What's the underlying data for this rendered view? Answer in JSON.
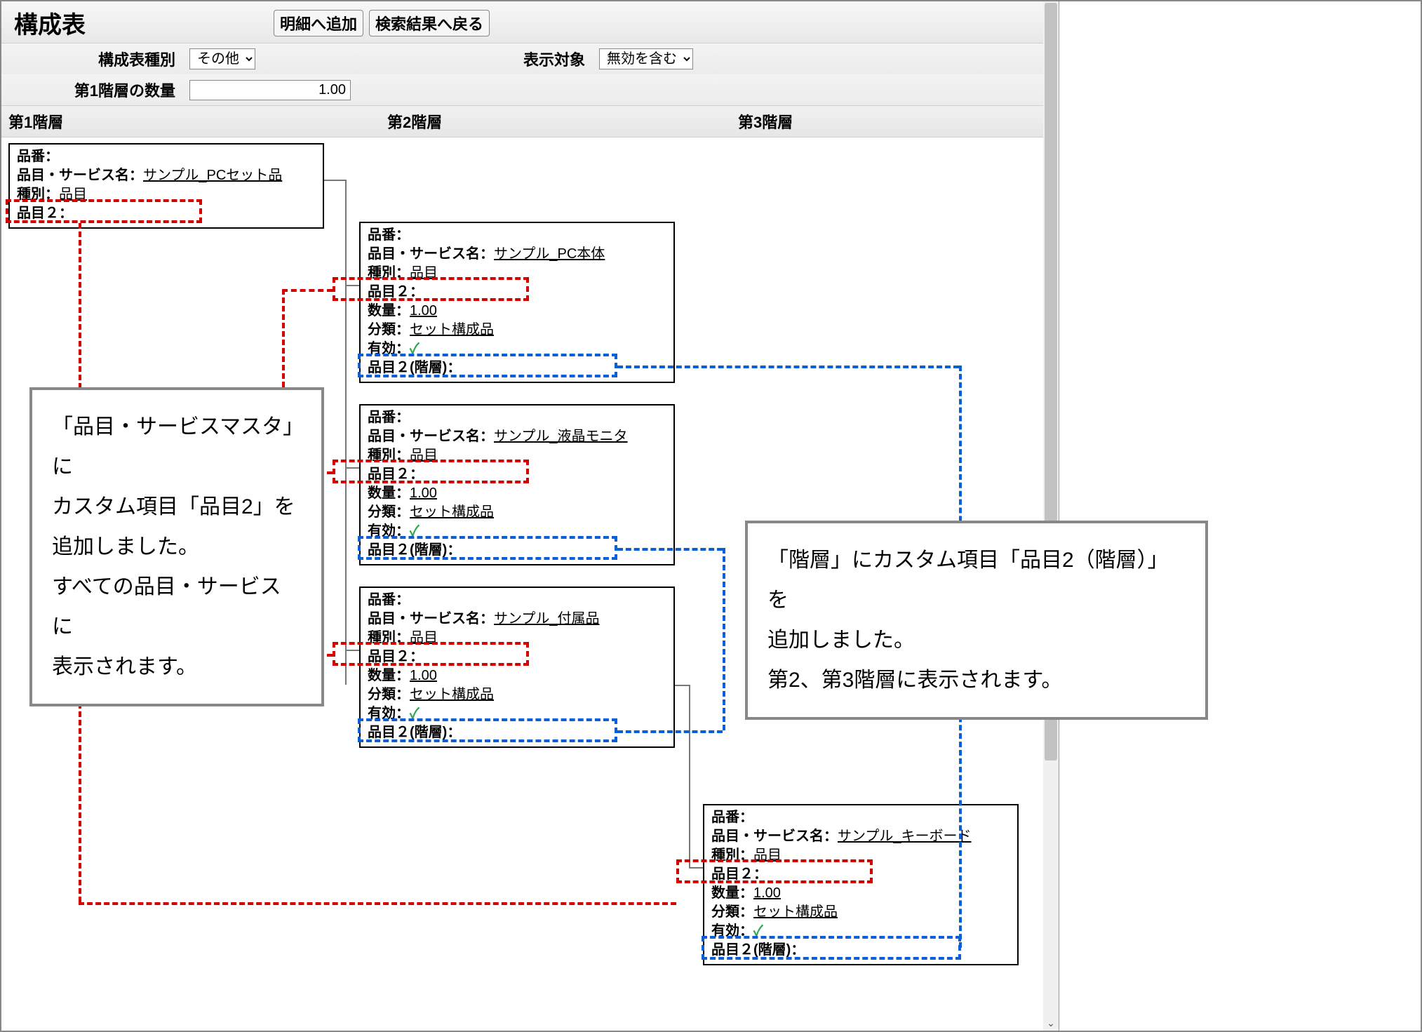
{
  "header": {
    "title": "構成表",
    "btn_add": "明細へ追加",
    "btn_back": "検索結果へ戻る"
  },
  "form": {
    "type_label": "構成表種別",
    "type_value": "その他",
    "target_label": "表示対象",
    "target_value": "無効を含む",
    "qty_label": "第1階層の数量",
    "qty_value": "1.00"
  },
  "columns": {
    "c1": "第1階層",
    "c2": "第2階層",
    "c3": "第3階層"
  },
  "labels": {
    "hinban": "品番：",
    "name": "品目・サービス名：",
    "type": "種別：",
    "type_val": "品目",
    "hin2": "品目２：",
    "qty": "数量：",
    "qty_val": "1.00",
    "cat": "分類：",
    "cat_val": "セット構成品",
    "valid": "有効：",
    "hin2_level": "品目２(階層)："
  },
  "nodes": {
    "l1": {
      "name": "サンプル_PCセット品"
    },
    "l2a": {
      "name": "サンプル_PC本体"
    },
    "l2b": {
      "name": "サンプル_液晶モニタ"
    },
    "l2c": {
      "name": "サンプル_付属品"
    },
    "l3": {
      "name": "サンプル_キーボード"
    }
  },
  "callouts": {
    "left": "「品目・サービスマスタ」に\nカスタム項目「品目2」を\n追加しました。\nすべての品目・サービスに\n表示されます。",
    "right": "「階層」にカスタム項目「品目2（階層）」を\n追加しました。\n第2、第3階層に表示されます。"
  }
}
